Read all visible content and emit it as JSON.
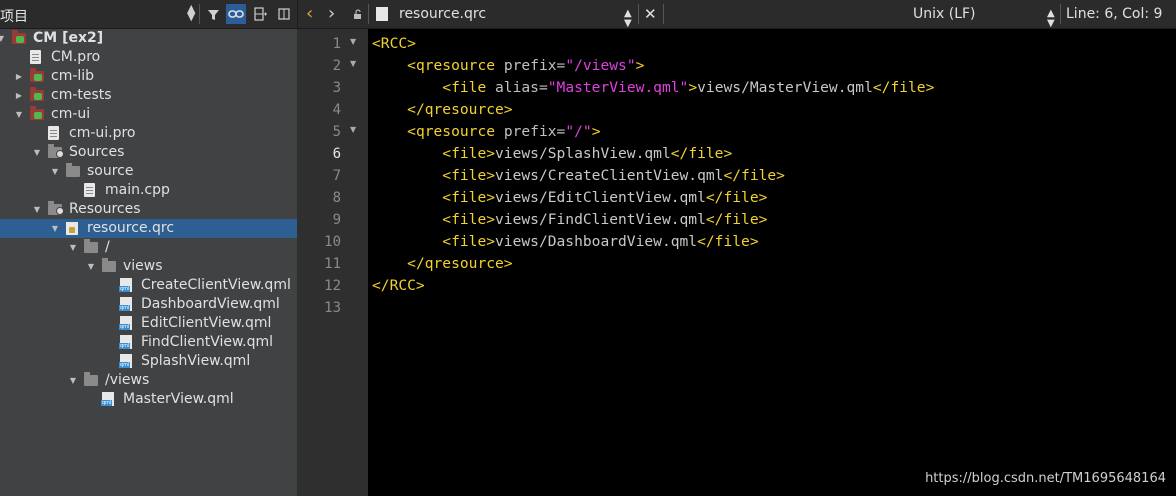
{
  "left_toolbar": {
    "title": "项目"
  },
  "tree": [
    {
      "label": "CM [ex2]",
      "level": 0,
      "arrow": "down",
      "icon": "proj",
      "bold": true
    },
    {
      "label": "CM.pro",
      "level": 1,
      "arrow": "",
      "icon": "file"
    },
    {
      "label": "cm-lib",
      "level": 1,
      "arrow": "right",
      "icon": "proj"
    },
    {
      "label": "cm-tests",
      "level": 1,
      "arrow": "right",
      "icon": "proj"
    },
    {
      "label": "cm-ui",
      "level": 1,
      "arrow": "down",
      "icon": "proj"
    },
    {
      "label": "cm-ui.pro",
      "level": 2,
      "arrow": "",
      "icon": "file"
    },
    {
      "label": "Sources",
      "level": 2,
      "arrow": "down",
      "icon": "src"
    },
    {
      "label": "source",
      "level": 3,
      "arrow": "down",
      "icon": "folder"
    },
    {
      "label": "main.cpp",
      "level": 4,
      "arrow": "",
      "icon": "file"
    },
    {
      "label": "Resources",
      "level": 2,
      "arrow": "down",
      "icon": "res"
    },
    {
      "label": "resource.qrc",
      "level": 3,
      "arrow": "down",
      "icon": "lock",
      "selected": true
    },
    {
      "label": "/",
      "level": 4,
      "arrow": "down",
      "icon": "folder"
    },
    {
      "label": "views",
      "level": 5,
      "arrow": "down",
      "icon": "folder"
    },
    {
      "label": "CreateClientView.qml",
      "level": 6,
      "arrow": "",
      "icon": "qml"
    },
    {
      "label": "DashboardView.qml",
      "level": 6,
      "arrow": "",
      "icon": "qml"
    },
    {
      "label": "EditClientView.qml",
      "level": 6,
      "arrow": "",
      "icon": "qml"
    },
    {
      "label": "FindClientView.qml",
      "level": 6,
      "arrow": "",
      "icon": "qml"
    },
    {
      "label": "SplashView.qml",
      "level": 6,
      "arrow": "",
      "icon": "qml"
    },
    {
      "label": "/views",
      "level": 4,
      "arrow": "down",
      "icon": "folder"
    },
    {
      "label": "MasterView.qml",
      "level": 5,
      "arrow": "",
      "icon": "qml"
    }
  ],
  "editor_toolbar": {
    "file_name": "resource.qrc",
    "line_ending": "Unix (LF)",
    "position": "Line: 6, Col: 9"
  },
  "editor": {
    "current_line": 6,
    "line_numbers": [
      "1",
      "2",
      "3",
      "4",
      "5",
      "6",
      "7",
      "8",
      "9",
      "10",
      "11",
      "12",
      "13"
    ],
    "fold_lines": [
      1,
      2,
      5
    ],
    "lines": [
      [
        [
          "tag",
          "<RCC>"
        ]
      ],
      [
        [
          "txt",
          "    "
        ],
        [
          "tag",
          "<qresource"
        ],
        [
          "attr",
          " prefix="
        ],
        [
          "str",
          "\"/views\""
        ],
        [
          "tag",
          ">"
        ]
      ],
      [
        [
          "txt",
          "        "
        ],
        [
          "tag",
          "<file"
        ],
        [
          "attr",
          " alias="
        ],
        [
          "str",
          "\"MasterView.qml\""
        ],
        [
          "tag",
          ">"
        ],
        [
          "txt",
          "views/MasterView.qml"
        ],
        [
          "tag",
          "</file>"
        ]
      ],
      [
        [
          "txt",
          "    "
        ],
        [
          "tag",
          "</qresource>"
        ]
      ],
      [
        [
          "txt",
          "    "
        ],
        [
          "tag",
          "<qresource"
        ],
        [
          "attr",
          " prefix="
        ],
        [
          "str",
          "\"/\""
        ],
        [
          "tag",
          ">"
        ]
      ],
      [
        [
          "txt",
          "        "
        ],
        [
          "tag",
          "<file>"
        ],
        [
          "txt",
          "views/SplashView.qml"
        ],
        [
          "tag",
          "</file>"
        ]
      ],
      [
        [
          "txt",
          "        "
        ],
        [
          "tag",
          "<file>"
        ],
        [
          "txt",
          "views/CreateClientView.qml"
        ],
        [
          "tag",
          "</file>"
        ]
      ],
      [
        [
          "txt",
          "        "
        ],
        [
          "tag",
          "<file>"
        ],
        [
          "txt",
          "views/EditClientView.qml"
        ],
        [
          "tag",
          "</file>"
        ]
      ],
      [
        [
          "txt",
          "        "
        ],
        [
          "tag",
          "<file>"
        ],
        [
          "txt",
          "views/FindClientView.qml"
        ],
        [
          "tag",
          "</file>"
        ]
      ],
      [
        [
          "txt",
          "        "
        ],
        [
          "tag",
          "<file>"
        ],
        [
          "txt",
          "views/DashboardView.qml"
        ],
        [
          "tag",
          "</file>"
        ]
      ],
      [
        [
          "txt",
          "    "
        ],
        [
          "tag",
          "</qresource>"
        ]
      ],
      [
        [
          "tag",
          "</RCC>"
        ]
      ],
      []
    ]
  },
  "watermark": "https://blog.csdn.net/TM1695648164"
}
